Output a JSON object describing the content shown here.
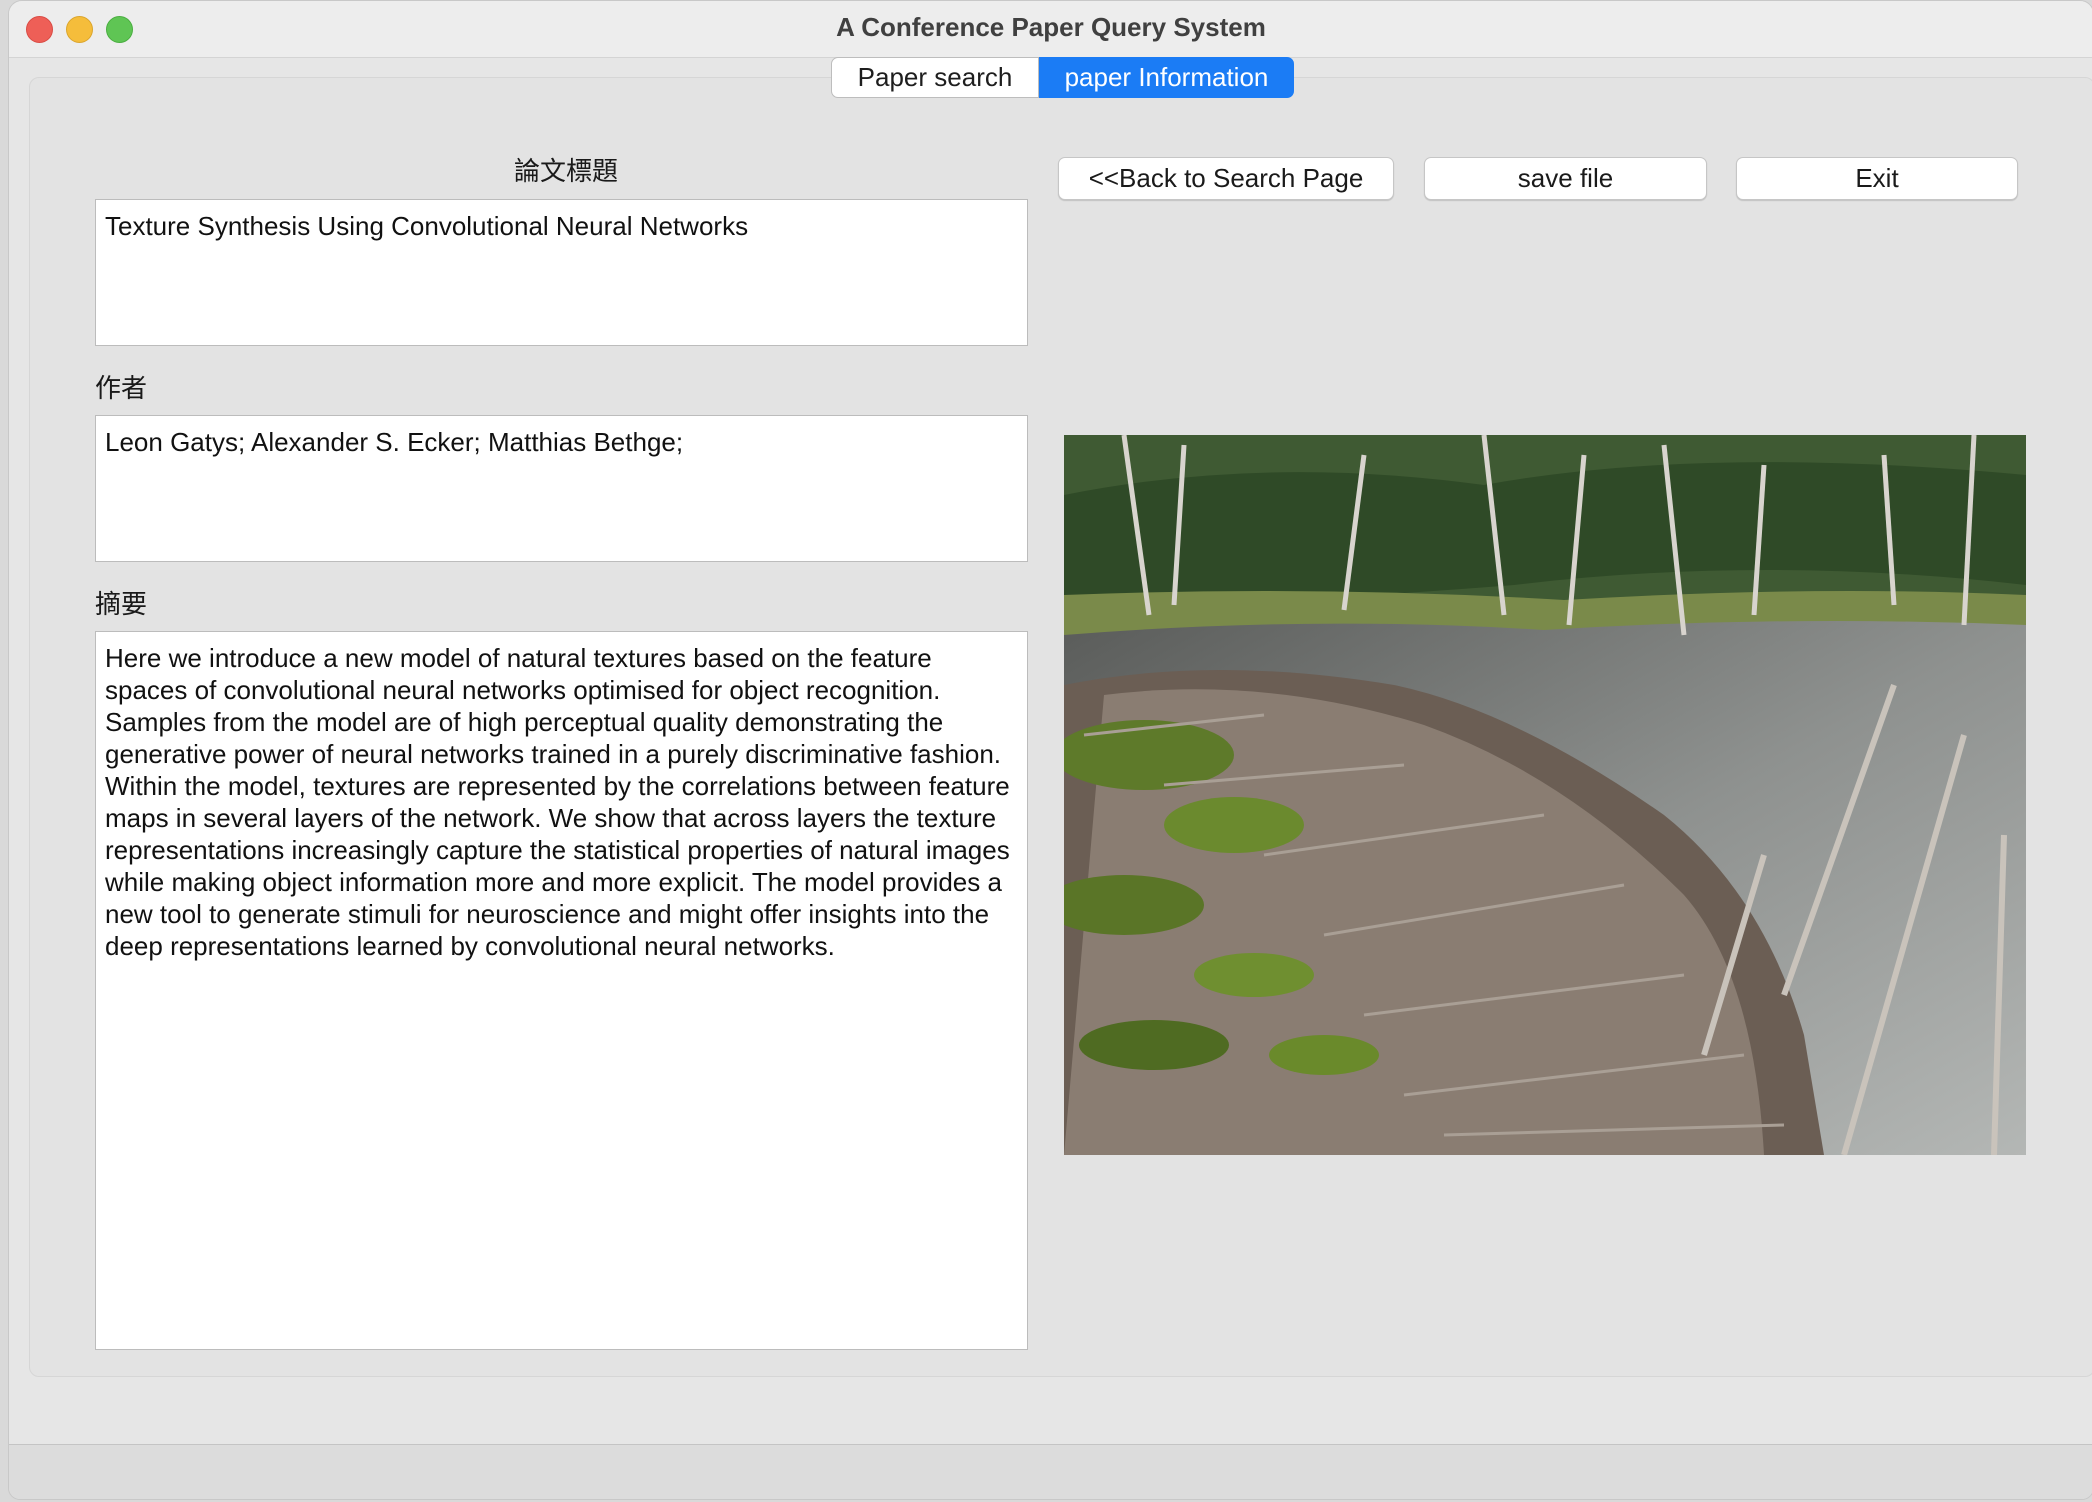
{
  "window": {
    "title": "A Conference Paper Query System"
  },
  "tabs": [
    {
      "label": "Paper search",
      "selected": false
    },
    {
      "label": "paper Information",
      "selected": true
    }
  ],
  "fields": {
    "title_label": "論文標題",
    "title_value": "Texture Synthesis Using Convolutional Neural Networks",
    "authors_label": "作者",
    "authors_value": "Leon Gatys; Alexander S. Ecker; Matthias Bethge;",
    "abstract_label": "摘要",
    "abstract_value": "Here we introduce a new model of natural textures based on the feature spaces of convolutional neural networks optimised for object recognition. Samples from the model are of high perceptual quality demonstrating the generative power of neural networks trained in a purely discriminative fashion. Within the model, textures are represented by the correlations between feature maps in several layers of the network. We show that across layers the texture representations increasingly capture the statistical properties of natural images while making object information more and more explicit. The model provides a new tool to generate stimuli for neuroscience and might offer insights into the deep representations learned by convolutional neural networks."
  },
  "buttons": {
    "back": "<<Back to Search Page",
    "save": "save file",
    "exit": "Exit"
  },
  "colors": {
    "accent": "#1b7cf5",
    "close": "#ee5f57",
    "minimize": "#f5bd3b",
    "zoom": "#5fc554"
  }
}
